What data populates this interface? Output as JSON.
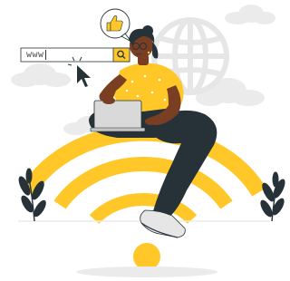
{
  "search": {
    "text": "www",
    "has_caret": true
  },
  "icons": [
    "search-icon",
    "thumbs-up-icon",
    "cursor-arrow-icon",
    "globe-icon",
    "wifi-icon",
    "laptop-icon"
  ],
  "colors": {
    "accent_yellow": "#FFC727",
    "skin": "#7A3F23",
    "pants": "#263238",
    "cloud_gray": "#EBEBEB",
    "globe_gray": "#E6E6E6",
    "laptop_gray": "#D9D9D9"
  }
}
